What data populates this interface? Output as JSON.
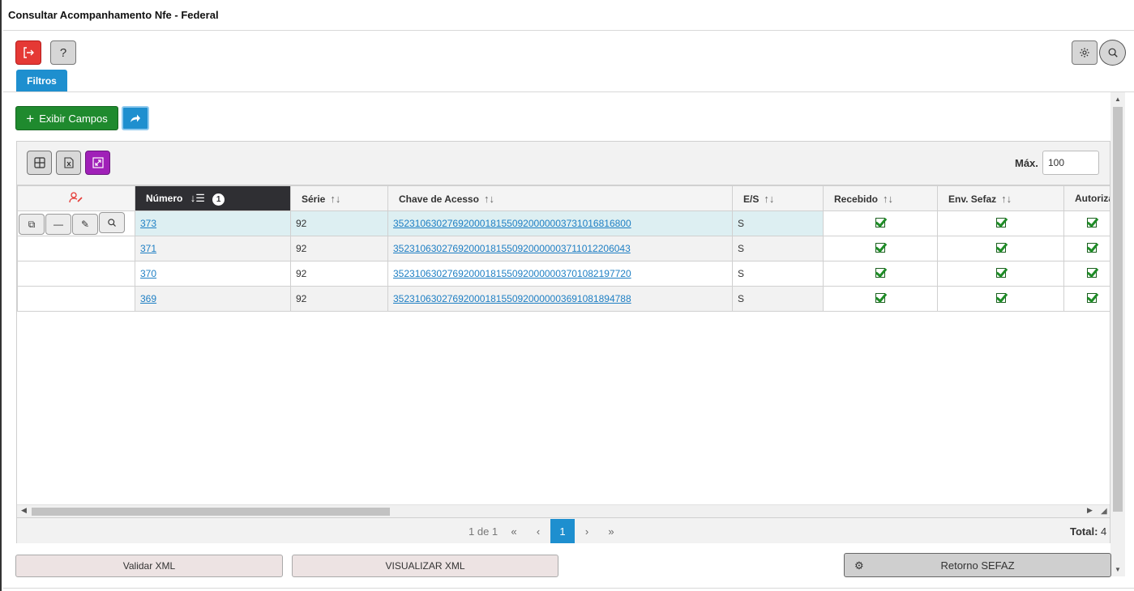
{
  "window": {
    "title": "Consultar Acompanhamento Nfe - Federal"
  },
  "toolbar": {
    "exit_icon": "exit-icon",
    "help_icon": "question-icon",
    "help_glyph": "?",
    "settings_icon": "gear-icon",
    "search_icon": "search-icon"
  },
  "tabs": {
    "filtros": "Filtros"
  },
  "actions": {
    "exibir_campos_label": "Exibir Campos",
    "share_icon": "share-icon"
  },
  "grid": {
    "max_label": "Máx.",
    "max_value": "100",
    "columns": [
      {
        "key": "numero",
        "label": "Número",
        "sorted": true,
        "sort_order": "1"
      },
      {
        "key": "serie",
        "label": "Série"
      },
      {
        "key": "chave",
        "label": "Chave de Acesso"
      },
      {
        "key": "es",
        "label": "E/S"
      },
      {
        "key": "recebido",
        "label": "Recebido"
      },
      {
        "key": "env_sefaz",
        "label": "Env. Sefaz"
      },
      {
        "key": "autoriza",
        "label": "Autoriza"
      }
    ],
    "rows": [
      {
        "numero": "373",
        "serie": "92",
        "chave": "35231063027692000181550920000003731016816800",
        "es": "S",
        "recebido": true,
        "env_sefaz": true,
        "autoriza": true
      },
      {
        "numero": "371",
        "serie": "92",
        "chave": "35231063027692000181550920000003711012206043",
        "es": "S",
        "recebido": true,
        "env_sefaz": true,
        "autoriza": true
      },
      {
        "numero": "370",
        "serie": "92",
        "chave": "35231063027692000181550920000003701082197720",
        "es": "S",
        "recebido": true,
        "env_sefaz": true,
        "autoriza": true
      },
      {
        "numero": "369",
        "serie": "92",
        "chave": "35231063027692000181550920000003691081894788",
        "es": "S",
        "recebido": true,
        "env_sefaz": true,
        "autoriza": true
      }
    ]
  },
  "pager": {
    "info": "1 de 1",
    "first": "«",
    "prev": "‹",
    "current": "1",
    "next": "›",
    "last": "»",
    "total_label": "Total:",
    "total_value": "4"
  },
  "footer": {
    "validar_xml": "Validar XML",
    "visualizar_xml": "VISUALIZAR XML",
    "retorno_sefaz": "Retorno SEFAZ"
  },
  "colors": {
    "accent_blue": "#1e8fcf",
    "exit_red": "#e53935",
    "green": "#1f8a2e",
    "purple": "#a020b8"
  }
}
